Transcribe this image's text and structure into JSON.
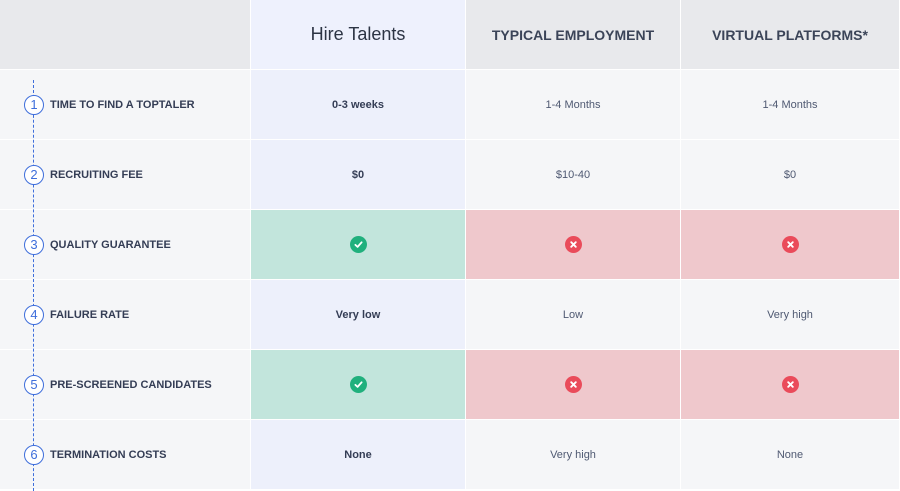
{
  "header": {
    "ours": "Hire Talents",
    "typical": "TYPICAL EMPLOYMENT",
    "virtual": "VIRTUAL PLATFORMS*"
  },
  "rows": [
    {
      "num": "1",
      "label": "TIME TO FIND A TOPTALER",
      "ours": "0-3 weeks",
      "typical": "1-4 Months",
      "virtual": "1-4 Months"
    },
    {
      "num": "2",
      "label": "RECRUITING FEE",
      "ours": "$0",
      "typical": "$10-40",
      "virtual": "$0"
    },
    {
      "num": "3",
      "label": "QUALITY GUARANTEE",
      "ours_icon": "check-icon",
      "typical_icon": "cross-icon",
      "virtual_icon": "cross-icon"
    },
    {
      "num": "4",
      "label": "FAILURE RATE",
      "ours": "Very low",
      "typical": "Low",
      "virtual": "Very high"
    },
    {
      "num": "5",
      "label": "PRE-SCREENED CANDIDATES",
      "ours_icon": "check-icon",
      "typical_icon": "cross-icon",
      "virtual_icon": "cross-icon"
    },
    {
      "num": "6",
      "label": "TERMINATION COSTS",
      "ours": "None",
      "typical": "Very high",
      "virtual": "None"
    }
  ],
  "colors": {
    "accent": "#3e6edb",
    "check": "#20b07d",
    "cross": "#ea4b5a",
    "good_cell": "#c2e5dc",
    "bad_cell": "#efc8cc"
  }
}
